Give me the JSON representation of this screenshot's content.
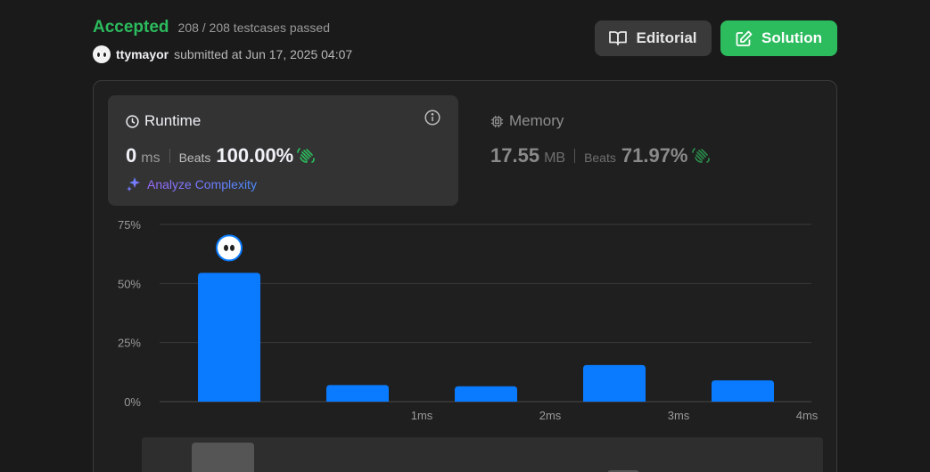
{
  "header": {
    "status": "Accepted",
    "testcases": "208 / 208 testcases passed",
    "username": "ttymayor",
    "submitted": "submitted at Jun 17, 2025 04:07"
  },
  "buttons": {
    "editorial": "Editorial",
    "solution": "Solution"
  },
  "runtime": {
    "title": "Runtime",
    "value": "0",
    "unit": "ms",
    "beats_label": "Beats",
    "beats": "100.00%",
    "analyze": "Analyze Complexity"
  },
  "memory": {
    "title": "Memory",
    "value": "17.55",
    "unit": "MB",
    "beats_label": "Beats",
    "beats": "71.97%"
  },
  "colors": {
    "accepted": "#2cbb5d",
    "bar": "#0a7bff",
    "wave": "#2cbb5d"
  },
  "chart_data": {
    "type": "bar",
    "categories": [
      "0ms",
      "1ms",
      "2ms",
      "3ms",
      "4ms"
    ],
    "tick_labels": [
      "",
      "1ms",
      "2ms",
      "3ms",
      "4ms"
    ],
    "values": [
      54.5,
      7,
      6.5,
      15.5,
      9
    ],
    "ylim": [
      0,
      75
    ],
    "yticks": [
      0,
      25,
      50,
      75
    ],
    "ytick_labels": [
      "0%",
      "25%",
      "50%",
      "75%"
    ],
    "grid": true,
    "highlight_index": 0
  }
}
